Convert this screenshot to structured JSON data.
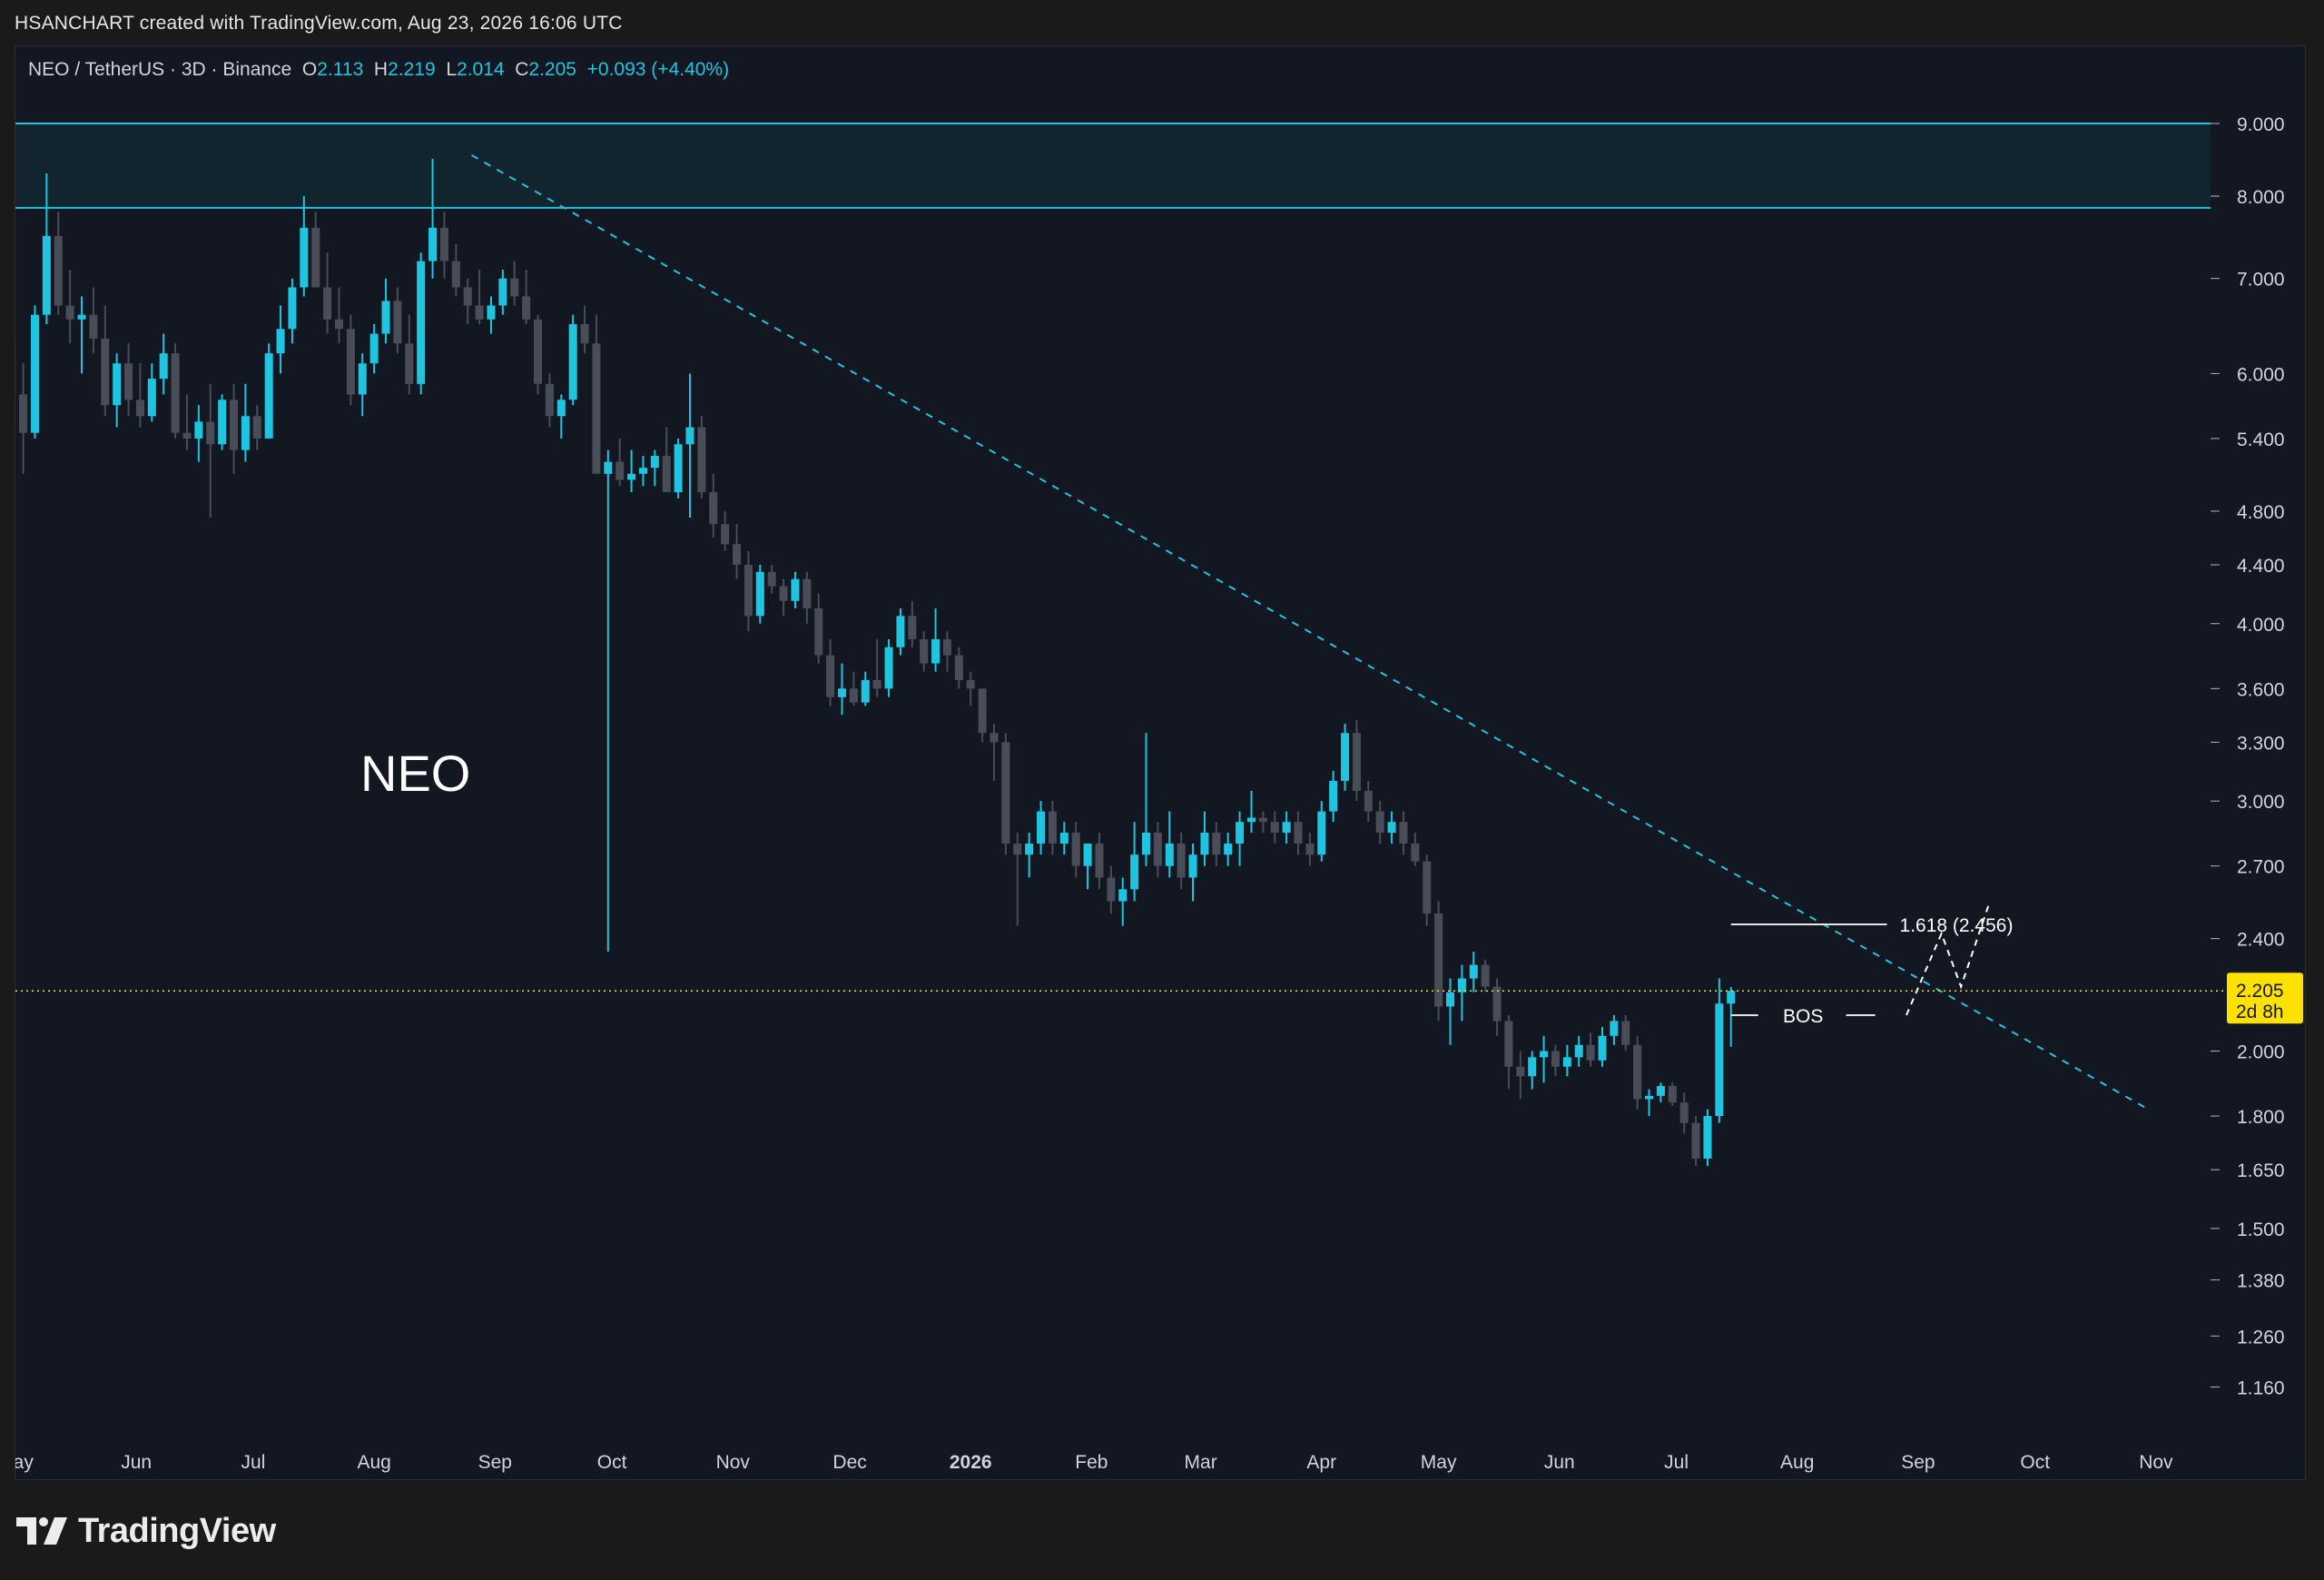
{
  "attribution": "HSANCHART created with TradingView.com, Aug 23, 2026 16:06 UTC",
  "header": {
    "symbol": "NEO / TetherUS · 3D · Binance",
    "o_label": "O",
    "o_value": "2.113",
    "h_label": "H",
    "h_value": "2.219",
    "l_label": "L",
    "l_value": "2.014",
    "c_label": "C",
    "c_value": "2.205",
    "change": "+0.093 (+4.40%)"
  },
  "brand": {
    "name": "TradingView",
    "logo_icon": "tradingview-logo-icon"
  },
  "colors": {
    "up": "#1fc5e0",
    "down": "#4a4d58",
    "trendline": "#1fc5e0",
    "zone_fill": "#12242e",
    "zone_line": "#1fc5e0",
    "price_label_bg": "#ffe100",
    "background": "#131722"
  },
  "chart_data": {
    "type": "candlestick",
    "scale": "log",
    "ylim": [
      1.08,
      10.2
    ],
    "x_range": [
      "2025-05-01",
      "2026-11-15"
    ],
    "title": "NEO",
    "y_ticks": [
      "9.000",
      "8.000",
      "7.000",
      "6.000",
      "5.400",
      "4.800",
      "4.400",
      "4.000",
      "3.600",
      "3.300",
      "3.000",
      "2.700",
      "2.400",
      "2.000",
      "1.800",
      "1.650",
      "1.500",
      "1.380",
      "1.260",
      "1.160"
    ],
    "x_ticks": [
      {
        "label": "May",
        "date": "2025-05-01"
      },
      {
        "label": "Jun",
        "date": "2025-06-01"
      },
      {
        "label": "Jul",
        "date": "2025-07-01"
      },
      {
        "label": "Aug",
        "date": "2025-08-01"
      },
      {
        "label": "Sep",
        "date": "2025-09-01"
      },
      {
        "label": "Oct",
        "date": "2025-10-01"
      },
      {
        "label": "Nov",
        "date": "2025-11-01"
      },
      {
        "label": "Dec",
        "date": "2025-12-01"
      },
      {
        "label": "2026",
        "date": "2026-01-01",
        "bold": true
      },
      {
        "label": "Feb",
        "date": "2026-02-01"
      },
      {
        "label": "Mar",
        "date": "2026-03-01"
      },
      {
        "label": "Apr",
        "date": "2026-04-01"
      },
      {
        "label": "May",
        "date": "2026-05-01"
      },
      {
        "label": "Jun",
        "date": "2026-06-01"
      },
      {
        "label": "Jul",
        "date": "2026-07-01"
      },
      {
        "label": "Aug",
        "date": "2026-08-01"
      },
      {
        "label": "Sep",
        "date": "2026-09-01"
      },
      {
        "label": "Oct",
        "date": "2026-10-01"
      },
      {
        "label": "Nov",
        "date": "2026-11-01"
      }
    ],
    "candle_interval_days": 3,
    "candles_start": "2025-04-30",
    "candles": [
      [
        6.3,
        6.4,
        5.4,
        5.8
      ],
      [
        5.8,
        6.1,
        5.1,
        5.45
      ],
      [
        5.45,
        6.7,
        5.4,
        6.6
      ],
      [
        6.6,
        8.3,
        6.5,
        7.5
      ],
      [
        7.5,
        7.8,
        6.6,
        6.7
      ],
      [
        6.7,
        7.1,
        6.3,
        6.55
      ],
      [
        6.55,
        6.8,
        6.0,
        6.6
      ],
      [
        6.6,
        6.9,
        6.2,
        6.35
      ],
      [
        6.35,
        6.7,
        5.6,
        5.7
      ],
      [
        5.7,
        6.2,
        5.5,
        6.1
      ],
      [
        6.1,
        6.3,
        5.6,
        5.75
      ],
      [
        5.75,
        6.1,
        5.5,
        5.6
      ],
      [
        5.6,
        6.1,
        5.55,
        5.95
      ],
      [
        5.95,
        6.4,
        5.8,
        6.2
      ],
      [
        6.2,
        6.3,
        5.4,
        5.45
      ],
      [
        5.45,
        5.8,
        5.3,
        5.4
      ],
      [
        5.4,
        5.7,
        5.2,
        5.55
      ],
      [
        5.55,
        5.9,
        4.75,
        5.35
      ],
      [
        5.35,
        5.8,
        5.3,
        5.75
      ],
      [
        5.75,
        5.9,
        5.1,
        5.3
      ],
      [
        5.3,
        5.9,
        5.2,
        5.6
      ],
      [
        5.6,
        5.7,
        5.3,
        5.4
      ],
      [
        5.4,
        6.3,
        5.4,
        6.2
      ],
      [
        6.2,
        6.7,
        6.0,
        6.45
      ],
      [
        6.45,
        7.0,
        6.3,
        6.9
      ],
      [
        6.9,
        8.0,
        6.8,
        7.6
      ],
      [
        7.6,
        7.8,
        6.9,
        6.9
      ],
      [
        6.9,
        7.3,
        6.4,
        6.55
      ],
      [
        6.55,
        6.9,
        6.3,
        6.45
      ],
      [
        6.45,
        6.6,
        5.7,
        5.8
      ],
      [
        5.8,
        6.2,
        5.6,
        6.1
      ],
      [
        6.1,
        6.5,
        6.0,
        6.4
      ],
      [
        6.4,
        7.0,
        6.3,
        6.75
      ],
      [
        6.75,
        6.9,
        6.2,
        6.3
      ],
      [
        6.3,
        6.6,
        5.8,
        5.9
      ],
      [
        5.9,
        7.3,
        5.8,
        7.2
      ],
      [
        7.2,
        8.5,
        7.0,
        7.6
      ],
      [
        7.6,
        7.8,
        7.0,
        7.2
      ],
      [
        7.2,
        7.4,
        6.8,
        6.9
      ],
      [
        6.9,
        7.0,
        6.5,
        6.7
      ],
      [
        6.7,
        7.1,
        6.5,
        6.55
      ],
      [
        6.55,
        6.8,
        6.4,
        6.7
      ],
      [
        6.7,
        7.1,
        6.6,
        7.0
      ],
      [
        7.0,
        7.2,
        6.7,
        6.8
      ],
      [
        6.8,
        7.1,
        6.5,
        6.55
      ],
      [
        6.55,
        6.6,
        5.8,
        5.9
      ],
      [
        5.9,
        6.0,
        5.5,
        5.6
      ],
      [
        5.6,
        5.8,
        5.4,
        5.75
      ],
      [
        5.75,
        6.6,
        5.7,
        6.5
      ],
      [
        6.5,
        6.7,
        6.2,
        6.3
      ],
      [
        6.3,
        6.6,
        5.1,
        5.1
      ],
      [
        5.1,
        5.3,
        2.35,
        5.2
      ],
      [
        5.2,
        5.4,
        5.0,
        5.05
      ],
      [
        5.05,
        5.3,
        4.95,
        5.1
      ],
      [
        5.1,
        5.25,
        5.0,
        5.15
      ],
      [
        5.15,
        5.3,
        5.0,
        5.25
      ],
      [
        5.25,
        5.5,
        4.95,
        4.95
      ],
      [
        4.95,
        5.4,
        4.9,
        5.35
      ],
      [
        5.35,
        6.0,
        4.75,
        5.5
      ],
      [
        5.5,
        5.6,
        4.9,
        4.95
      ],
      [
        4.95,
        5.1,
        4.6,
        4.7
      ],
      [
        4.7,
        4.8,
        4.5,
        4.55
      ],
      [
        4.55,
        4.7,
        4.3,
        4.4
      ],
      [
        4.4,
        4.5,
        3.95,
        4.05
      ],
      [
        4.05,
        4.4,
        4.0,
        4.35
      ],
      [
        4.35,
        4.4,
        4.2,
        4.25
      ],
      [
        4.25,
        4.3,
        4.05,
        4.15
      ],
      [
        4.15,
        4.35,
        4.1,
        4.3
      ],
      [
        4.3,
        4.35,
        4.0,
        4.1
      ],
      [
        4.1,
        4.2,
        3.75,
        3.8
      ],
      [
        3.8,
        3.9,
        3.5,
        3.55
      ],
      [
        3.55,
        3.75,
        3.45,
        3.6
      ],
      [
        3.6,
        3.7,
        3.5,
        3.52
      ],
      [
        3.52,
        3.7,
        3.5,
        3.65
      ],
      [
        3.65,
        3.9,
        3.55,
        3.6
      ],
      [
        3.6,
        3.9,
        3.55,
        3.85
      ],
      [
        3.85,
        4.1,
        3.8,
        4.05
      ],
      [
        4.05,
        4.15,
        3.85,
        3.9
      ],
      [
        3.9,
        3.95,
        3.7,
        3.75
      ],
      [
        3.75,
        4.1,
        3.7,
        3.9
      ],
      [
        3.9,
        3.95,
        3.7,
        3.8
      ],
      [
        3.8,
        3.85,
        3.6,
        3.65
      ],
      [
        3.65,
        3.7,
        3.5,
        3.6
      ],
      [
        3.6,
        3.6,
        3.3,
        3.35
      ],
      [
        3.35,
        3.4,
        3.1,
        3.3
      ],
      [
        3.3,
        3.35,
        2.75,
        2.8
      ],
      [
        2.8,
        2.85,
        2.45,
        2.75
      ],
      [
        2.75,
        2.85,
        2.65,
        2.8
      ],
      [
        2.8,
        3.0,
        2.75,
        2.95
      ],
      [
        2.95,
        3.0,
        2.75,
        2.8
      ],
      [
        2.8,
        2.9,
        2.75,
        2.85
      ],
      [
        2.85,
        2.9,
        2.65,
        2.7
      ],
      [
        2.7,
        2.8,
        2.6,
        2.8
      ],
      [
        2.8,
        2.85,
        2.6,
        2.65
      ],
      [
        2.65,
        2.7,
        2.5,
        2.55
      ],
      [
        2.55,
        2.65,
        2.45,
        2.6
      ],
      [
        2.6,
        2.9,
        2.55,
        2.75
      ],
      [
        2.75,
        3.35,
        2.7,
        2.85
      ],
      [
        2.85,
        2.9,
        2.65,
        2.7
      ],
      [
        2.7,
        2.95,
        2.65,
        2.8
      ],
      [
        2.8,
        2.85,
        2.6,
        2.65
      ],
      [
        2.65,
        2.8,
        2.55,
        2.75
      ],
      [
        2.75,
        2.95,
        2.7,
        2.85
      ],
      [
        2.85,
        2.9,
        2.7,
        2.75
      ],
      [
        2.75,
        2.85,
        2.7,
        2.8
      ],
      [
        2.8,
        2.95,
        2.7,
        2.9
      ],
      [
        2.9,
        3.05,
        2.85,
        2.92
      ],
      [
        2.92,
        2.95,
        2.85,
        2.9
      ],
      [
        2.9,
        2.95,
        2.8,
        2.85
      ],
      [
        2.85,
        2.95,
        2.8,
        2.9
      ],
      [
        2.9,
        2.95,
        2.75,
        2.8
      ],
      [
        2.8,
        2.85,
        2.7,
        2.75
      ],
      [
        2.75,
        3.0,
        2.72,
        2.95
      ],
      [
        2.95,
        3.15,
        2.9,
        3.1
      ],
      [
        3.1,
        3.4,
        3.05,
        3.35
      ],
      [
        3.35,
        3.42,
        3.0,
        3.05
      ],
      [
        3.05,
        3.1,
        2.9,
        2.95
      ],
      [
        2.95,
        3.0,
        2.8,
        2.85
      ],
      [
        2.85,
        2.95,
        2.8,
        2.9
      ],
      [
        2.9,
        2.95,
        2.75,
        2.8
      ],
      [
        2.8,
        2.85,
        2.7,
        2.72
      ],
      [
        2.72,
        2.75,
        2.45,
        2.5
      ],
      [
        2.5,
        2.55,
        2.1,
        2.15
      ],
      [
        2.15,
        2.25,
        2.02,
        2.2
      ],
      [
        2.2,
        2.3,
        2.1,
        2.25
      ],
      [
        2.25,
        2.35,
        2.2,
        2.3
      ],
      [
        2.3,
        2.32,
        2.2,
        2.22
      ],
      [
        2.22,
        2.25,
        2.05,
        2.1
      ],
      [
        2.1,
        2.12,
        1.88,
        1.95
      ],
      [
        1.95,
        2.0,
        1.85,
        1.92
      ],
      [
        1.92,
        2.0,
        1.88,
        1.98
      ],
      [
        1.98,
        2.05,
        1.9,
        2.0
      ],
      [
        2.0,
        2.02,
        1.92,
        1.95
      ],
      [
        1.95,
        2.02,
        1.92,
        1.98
      ],
      [
        1.98,
        2.05,
        1.95,
        2.02
      ],
      [
        2.02,
        2.06,
        1.95,
        1.97
      ],
      [
        1.97,
        2.08,
        1.95,
        2.05
      ],
      [
        2.05,
        2.12,
        2.02,
        2.1
      ],
      [
        2.1,
        2.12,
        2.0,
        2.02
      ],
      [
        2.02,
        2.05,
        1.82,
        1.85
      ],
      [
        1.85,
        1.88,
        1.8,
        1.86
      ],
      [
        1.86,
        1.9,
        1.84,
        1.89
      ],
      [
        1.89,
        1.9,
        1.83,
        1.84
      ],
      [
        1.84,
        1.87,
        1.75,
        1.78
      ],
      [
        1.78,
        1.8,
        1.66,
        1.68
      ],
      [
        1.68,
        1.82,
        1.66,
        1.8
      ],
      [
        1.8,
        2.25,
        1.78,
        2.16
      ],
      [
        2.16,
        2.219,
        2.014,
        2.205
      ]
    ],
    "resistance_zone": {
      "low": 7.85,
      "high": 9.0
    },
    "trendline": {
      "from": {
        "date": "2025-08-26",
        "price": 8.55
      },
      "to": {
        "date": "2026-10-30",
        "price": 1.82
      }
    },
    "last_price": 2.205,
    "price_label": {
      "price": "2.205",
      "countdown": "2d 8h"
    },
    "annotations": {
      "fib": {
        "label": "1.618 (2.456)",
        "price": 2.456,
        "from_date": "2026-07-15",
        "to_date": "2026-08-24"
      },
      "bos": {
        "label": "BOS",
        "price": 2.12,
        "from_date": "2026-07-15",
        "to_date": "2026-08-21"
      },
      "projection": [
        {
          "date": "2026-08-29",
          "price": 2.12
        },
        {
          "date": "2026-09-07",
          "price": 2.42
        },
        {
          "date": "2026-09-12",
          "price": 2.22
        },
        {
          "date": "2026-09-19",
          "price": 2.53
        }
      ]
    }
  }
}
